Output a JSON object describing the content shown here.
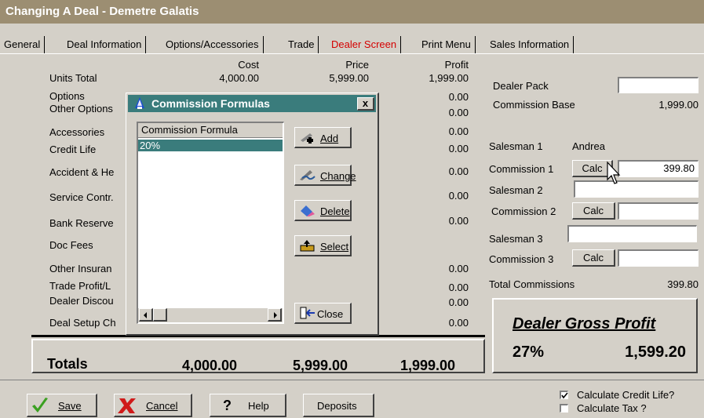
{
  "window": {
    "title": "Changing A Deal - Demetre Galatis"
  },
  "tabs": [
    "General",
    "Deal Information",
    "Options/Accessories",
    "Trade",
    "Dealer Screen",
    "Print Menu",
    "Sales Information"
  ],
  "active_tab": "Dealer Screen",
  "grid": {
    "headers": {
      "cost": "Cost",
      "price": "Price",
      "profit": "Profit"
    },
    "rows": [
      {
        "label": "Units Total",
        "cost": "4,000.00",
        "price": "5,999.00",
        "profit": "1,999.00"
      },
      {
        "label": "Options",
        "profit": "0.00"
      },
      {
        "label": "Other Options",
        "profit": "0.00"
      },
      {
        "label": "Accessories",
        "profit": "0.00"
      },
      {
        "label": "Credit Life",
        "profit": "0.00"
      },
      {
        "label": "Accident & He",
        "profit": "0.00"
      },
      {
        "label": "Service Contr.",
        "profit": "0.00"
      },
      {
        "label": "Bank Reserve",
        "profit": "0.00"
      },
      {
        "label": "Doc Fees",
        "profit": ""
      },
      {
        "label": "Other Insuran",
        "profit": "0.00"
      },
      {
        "label": "Trade Profit/L",
        "profit": "0.00"
      },
      {
        "label": "Dealer Discou",
        "profit": "0.00"
      },
      {
        "label": "Deal Setup Ch",
        "profit": "0.00"
      }
    ]
  },
  "totals": {
    "label": "Totals",
    "cost": "4,000.00",
    "price": "5,999.00",
    "profit": "1,999.00"
  },
  "right_panel": {
    "dealer_pack_label": "Dealer Pack",
    "dealer_pack_value": "",
    "commission_base_label": "Commission Base",
    "commission_base_value": "1,999.00",
    "salesman1_label": "Salesman 1",
    "salesman1_value": "Andrea",
    "commission1_label": "Commission 1",
    "commission1_value": "399.80",
    "salesman2_label": "Salesman 2",
    "salesman2_value": "",
    "commission2_label": "Commission 2",
    "commission2_value": "",
    "salesman3_label": "Salesman 3",
    "salesman3_value": "",
    "commission3_label": "Commission 3",
    "commission3_value": "",
    "calc_label": "Calc",
    "total_commissions_label": "Total Commissions",
    "total_commissions_value": "399.80"
  },
  "dealer_gross_profit": {
    "title": "Dealer Gross Profit",
    "percent": "27%",
    "amount": "1,599.20"
  },
  "dialog": {
    "title": "Commission Formulas",
    "list_header": "Commission Formula",
    "items": [
      "20%"
    ],
    "buttons": {
      "add": "Add",
      "change": "Change",
      "delete": "Delete",
      "select": "Select",
      "close": "Close"
    },
    "close_x": "x"
  },
  "bottom_buttons": {
    "save": "Save",
    "cancel": "Cancel",
    "help": "Help",
    "deposits": "Deposits"
  },
  "checkboxes": [
    {
      "label": "Calculate Credit Life?",
      "checked": true
    },
    {
      "label": "Calculate Tax ?",
      "checked": false
    }
  ],
  "colors": {
    "titlebar": "#9c8e72",
    "dialog_title": "#3a7c7c",
    "active_tab": "#d40000",
    "selection": "#3a7c7c"
  }
}
